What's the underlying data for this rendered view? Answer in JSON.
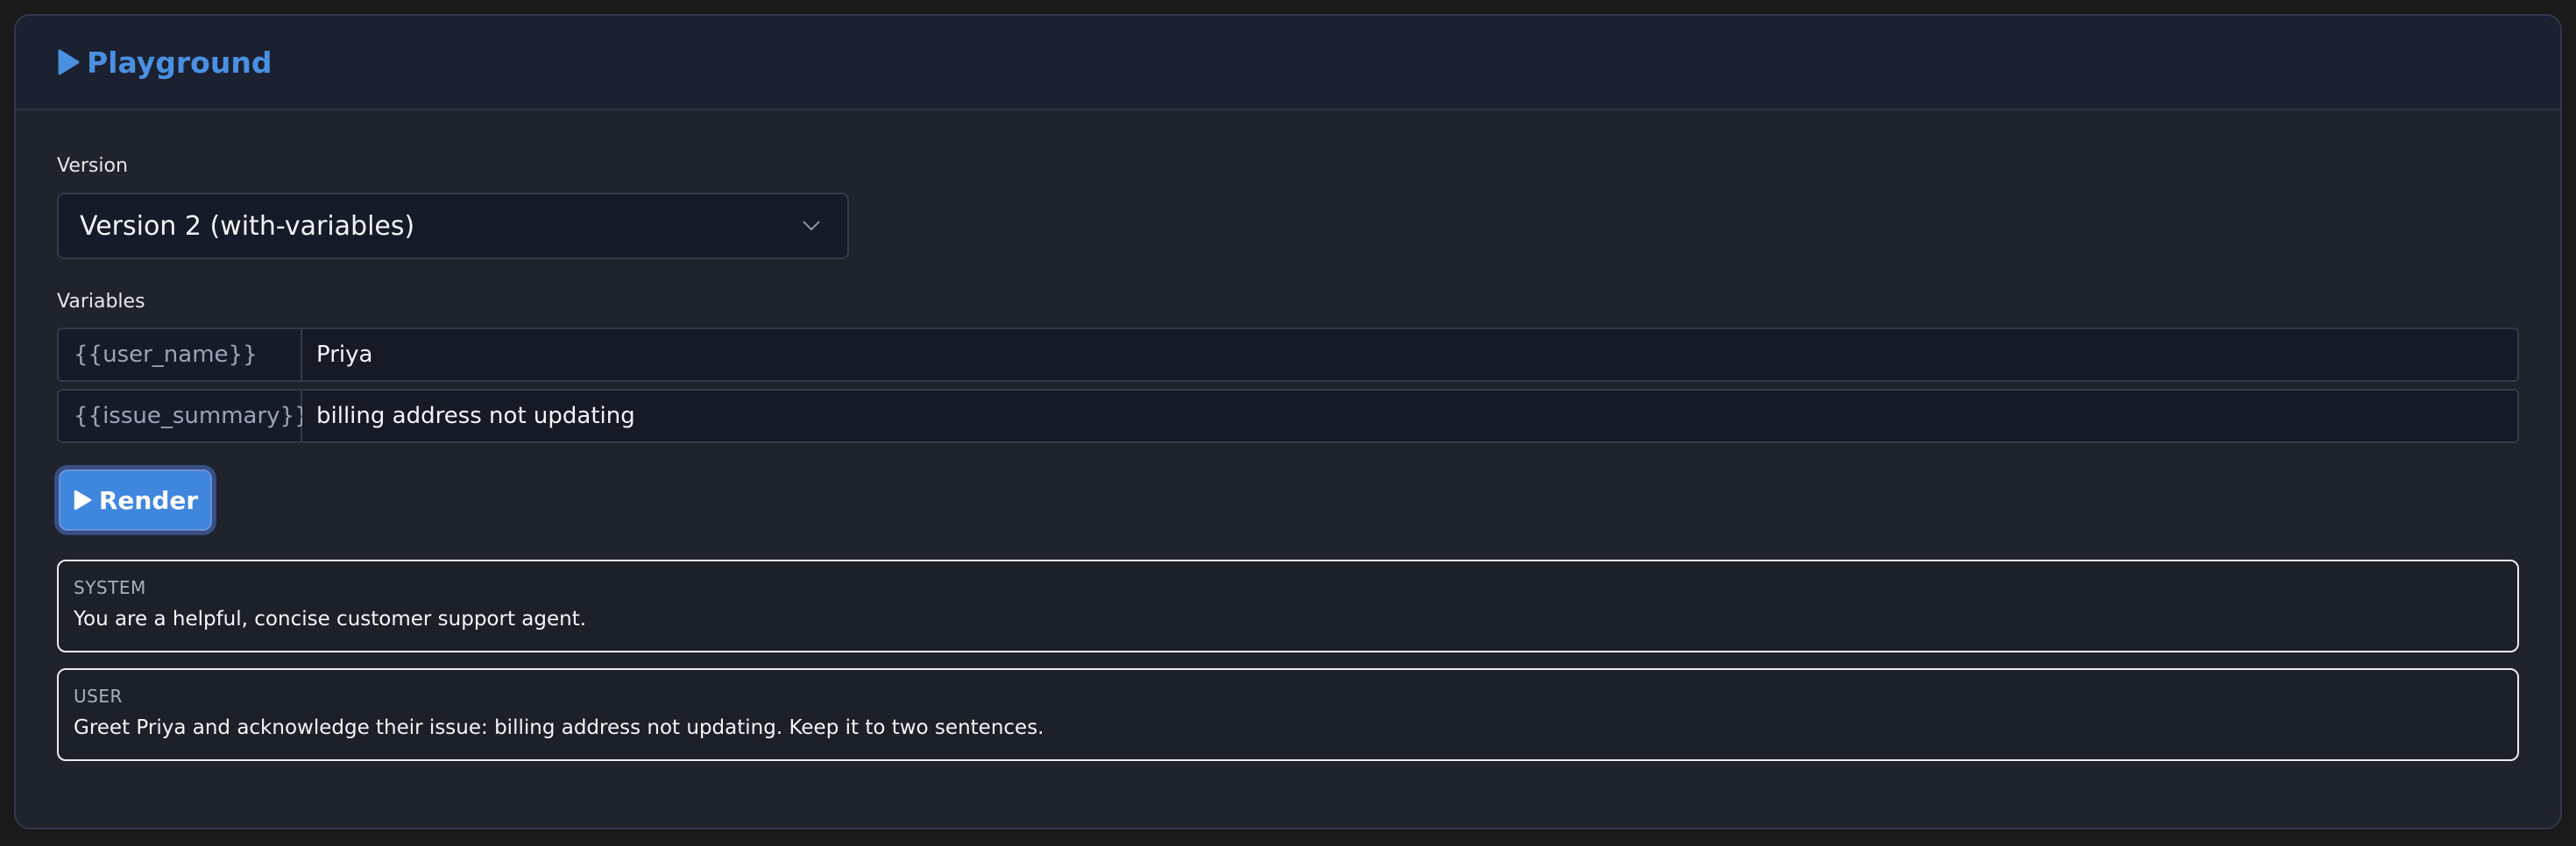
{
  "header": {
    "title": "Playground"
  },
  "version": {
    "label": "Version",
    "selected": "Version 2 (with-variables)"
  },
  "variables": {
    "label": "Variables",
    "rows": [
      {
        "key": "{{user_name}}",
        "value": "Priya"
      },
      {
        "key": "{{issue_summary}}",
        "value": "billing address not updating"
      }
    ]
  },
  "render_button": {
    "label": "Render"
  },
  "messages": [
    {
      "role": "SYSTEM",
      "text": "You are a helpful, concise customer support agent."
    },
    {
      "role": "USER",
      "text": "Greet Priya and acknowledge their issue: billing address not updating. Keep it to two sentences."
    }
  ],
  "colors": {
    "accent": "#4a90e2",
    "background": "#1f232c",
    "header_background": "#1b2131",
    "button": "#3f86df"
  },
  "icons": {
    "title": "play-icon",
    "select": "chevron-down-icon",
    "button": "play-icon"
  }
}
